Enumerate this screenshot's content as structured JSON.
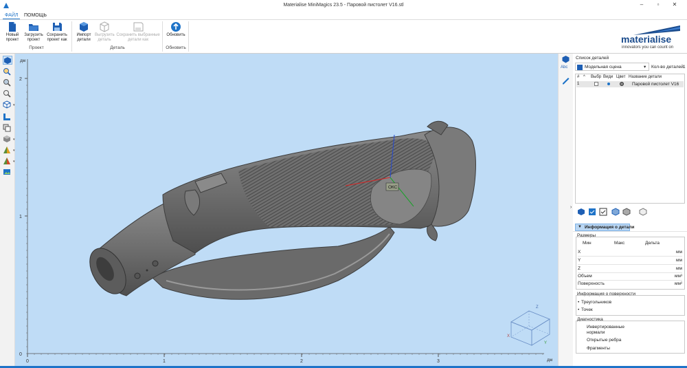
{
  "window": {
    "title": "Materialise MiniMagics 23.5 - Паровой пистолет V16.stl",
    "minimize": "–",
    "restore": "▫",
    "close": "✕"
  },
  "menu": {
    "file": "ФАЙЛ",
    "help": "ПОМОЩЬ"
  },
  "ribbon": {
    "new_project": "Новый проект",
    "load_project": "Загрузить проект",
    "save_project_as": "Сохранить проект как",
    "import_parts": "Импорт детали",
    "export_parts": "Выгрузить деталь",
    "save_selected_as": "Сохранить выбранные детали как",
    "refresh": "Обновить",
    "group_project": "Проект",
    "group_part": "Деталь",
    "group_refresh": "Обновить"
  },
  "logo": {
    "name": "materialise",
    "tagline": "innovators you can count on",
    "color": "#1a4b8c"
  },
  "viewport": {
    "axis_unit_y": "дм",
    "axis_unit_x": "дм",
    "y_ticks": [
      "2",
      "1",
      "0"
    ],
    "x_ticks": [
      "0",
      "1",
      "2",
      "3"
    ],
    "origin_label": "ОКС",
    "cube_labels": {
      "z": "Z",
      "x": "X",
      "y": "Y"
    },
    "background": "#bfdcf6"
  },
  "panel": {
    "parts_list_title": "Список деталей",
    "scene_select": "Модельная сцена",
    "parts_count_label": "Кол-во деталей:",
    "parts_count": "1",
    "columns": [
      "#",
      "^",
      "Выбр",
      "Види",
      "Цвет",
      "Название детали"
    ],
    "rows": [
      {
        "num": "1",
        "name": "Паровой пистолет V16"
      }
    ],
    "info_tab": "Информация о детали",
    "dimensions_title": "Размеры",
    "dim_headers": [
      "Мин",
      "Макс",
      "Дельта"
    ],
    "dims": [
      {
        "label": "X",
        "unit": "мм"
      },
      {
        "label": "Y",
        "unit": "мм"
      },
      {
        "label": "Z",
        "unit": "мм"
      },
      {
        "label": "Объем",
        "unit": "мм³"
      },
      {
        "label": "Поверхность",
        "unit": "мм²"
      }
    ],
    "surface_title": "Информация о поверхности",
    "triangles": "Треугольников",
    "points": "Точек",
    "diagnostics_title": "Диагностика",
    "inverted_normals": "Инвертированные нормали",
    "open_edges": "Открытые ребра",
    "fragments": "Фрагменты"
  }
}
